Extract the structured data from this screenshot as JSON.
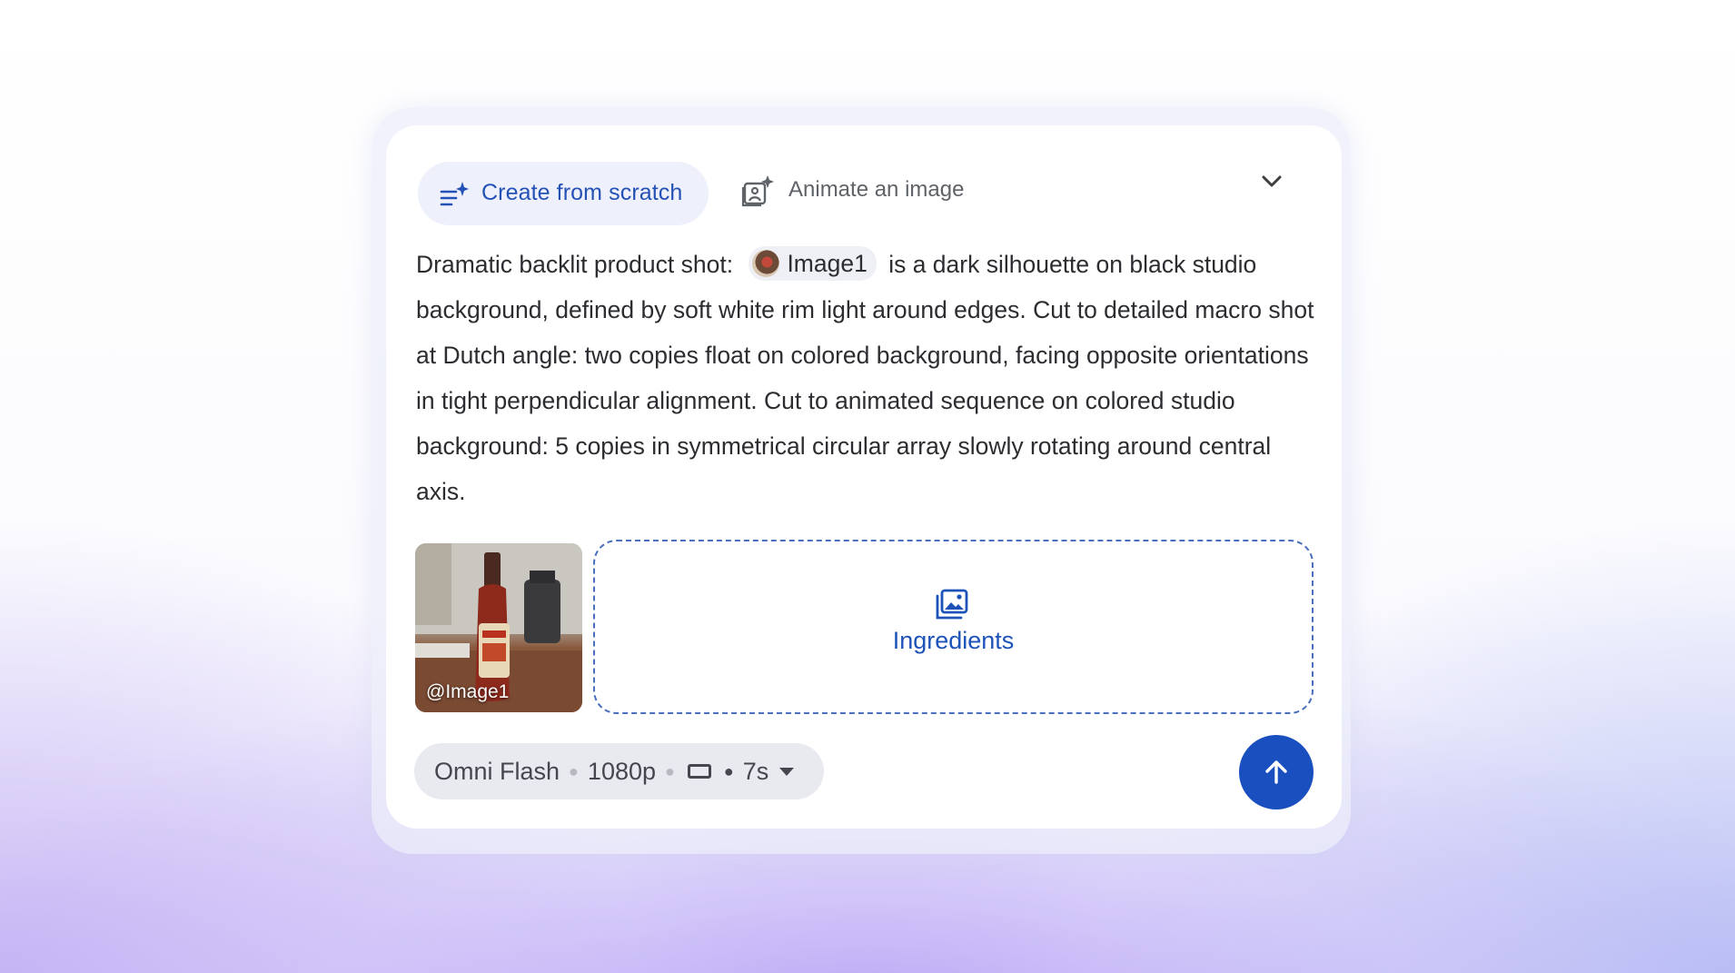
{
  "mode_tabs": [
    {
      "label": "Create from scratch",
      "icon": "sparkle-list-icon",
      "active": true
    },
    {
      "label": "Animate an image",
      "icon": "image-sparkle-icon",
      "active": false
    }
  ],
  "collapse_icon": "chevron-down-icon",
  "prompt": {
    "before": "Dramatic backlit product shot:",
    "mention": "Image1",
    "after": "is a dark silhouette on black studio background, defined by soft white rim light around edges. Cut to detailed macro shot at Dutch angle: two copies float on colored background, facing opposite orientations in tight perpendicular alignment. Cut to animated sequence on colored studio background: 5 copies in symmetrical circular array slowly rotating around central axis."
  },
  "attachments": {
    "image_tag": "@Image1",
    "dropzone_label": "Ingredients",
    "dropzone_icon": "image-stack-icon"
  },
  "settings": {
    "model": "Omni Flash",
    "resolution": "1080p",
    "aspect_icon": "landscape-ratio-icon",
    "duration": "7s"
  },
  "send_icon": "arrow-up-icon",
  "colors": {
    "accent": "#1a4fc0",
    "active_tab_bg": "#eef0fb",
    "active_tab_text": "#2451b5"
  }
}
